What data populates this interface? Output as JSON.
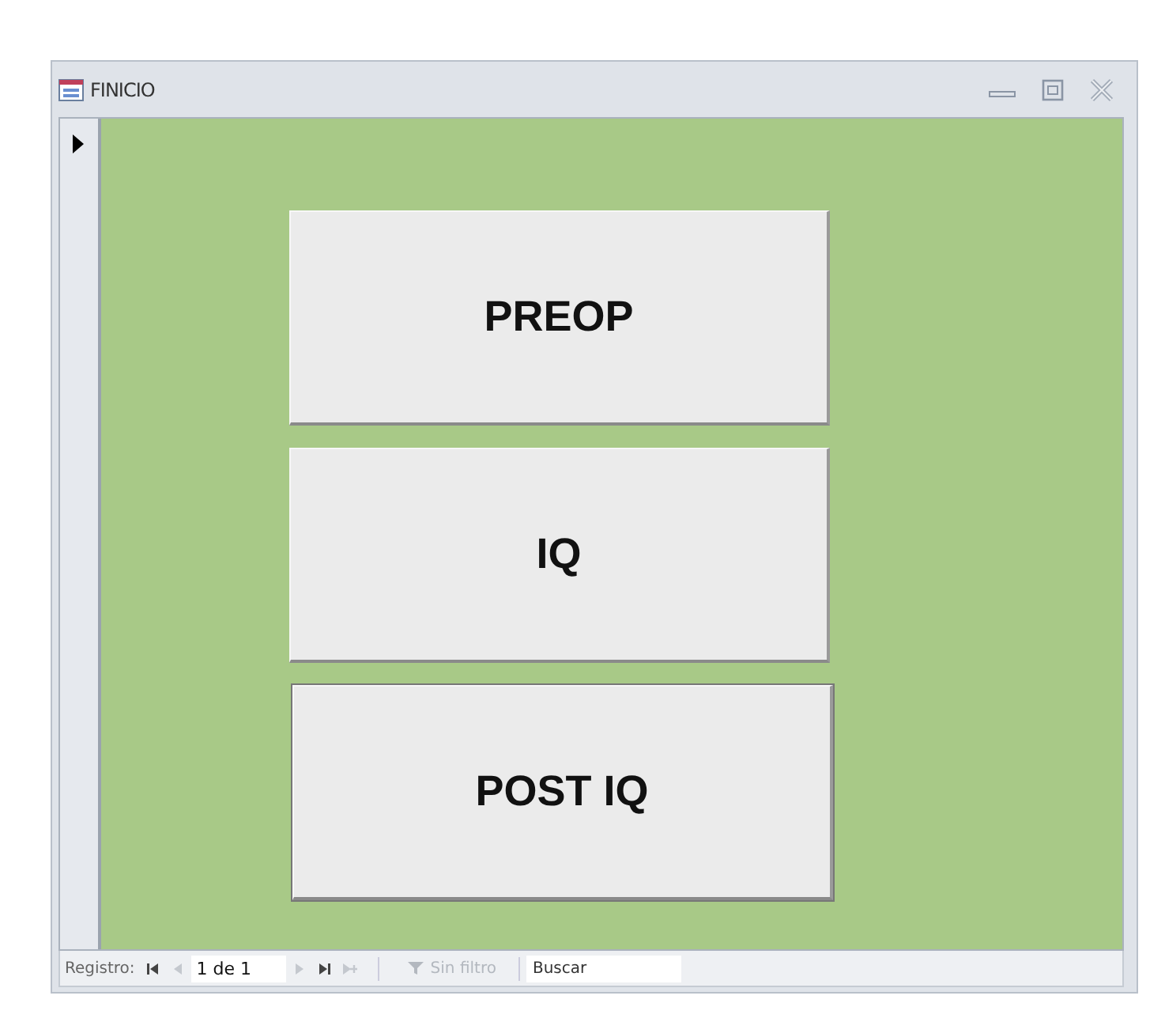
{
  "window": {
    "title": "FINICIO"
  },
  "buttons": [
    {
      "label": "PREOP",
      "focused": false
    },
    {
      "label": "IQ",
      "focused": false
    },
    {
      "label": "POST IQ",
      "focused": true
    }
  ],
  "navigation": {
    "label": "Registro:",
    "position": "1 de 1",
    "before": [
      {
        "kind": "first",
        "disabled": false
      },
      {
        "kind": "prev",
        "disabled": true
      }
    ],
    "after": [
      {
        "kind": "next",
        "disabled": true
      },
      {
        "kind": "last",
        "disabled": false
      },
      {
        "kind": "new",
        "disabled": true
      }
    ],
    "filter": {
      "label": "Sin filtro",
      "disabled": true
    },
    "search": {
      "placeholder": "Buscar"
    }
  }
}
